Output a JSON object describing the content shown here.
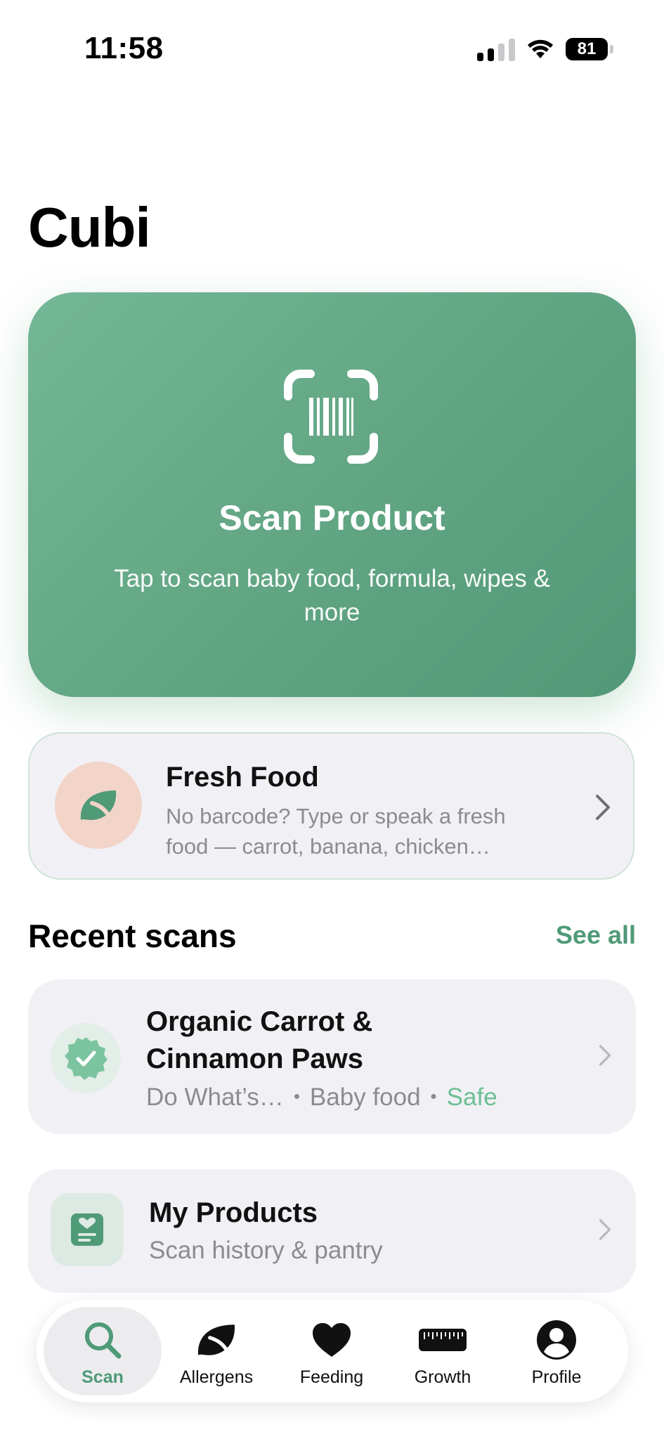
{
  "status_bar": {
    "time": "11:58",
    "battery": "81"
  },
  "app": {
    "title": "Cubi"
  },
  "scan_card": {
    "title": "Scan Product",
    "subtitle": "Tap to scan baby food, formula, wipes & more",
    "icon": "barcode-scan-icon"
  },
  "fresh_food": {
    "title": "Fresh Food",
    "subtitle": "No barcode? Type or speak a fresh food — carrot, banana, chicken…",
    "icon": "leaf-icon"
  },
  "recent": {
    "heading": "Recent scans",
    "see_all": "See all",
    "items": [
      {
        "title": "Organic Carrot & Cinnamon Paws",
        "brand": "Do What’s…",
        "category": "Baby food",
        "status": "Safe",
        "icon": "verified-badge-icon"
      }
    ]
  },
  "my_products": {
    "title": "My Products",
    "subtitle": "Scan history & pantry",
    "icon": "heart-list-icon"
  },
  "tabs": [
    {
      "label": "Scan",
      "icon": "search-icon",
      "active": true
    },
    {
      "label": "Allergens",
      "icon": "leaf-icon",
      "active": false
    },
    {
      "label": "Feeding",
      "icon": "heart-icon",
      "active": false
    },
    {
      "label": "Growth",
      "icon": "ruler-icon",
      "active": false
    },
    {
      "label": "Profile",
      "icon": "person-icon",
      "active": false
    }
  ],
  "colors": {
    "accent": "#4f9a77",
    "card_green": "#62a684",
    "safe": "#6cbf94",
    "fresh_avatar": "#f3d4c9"
  }
}
